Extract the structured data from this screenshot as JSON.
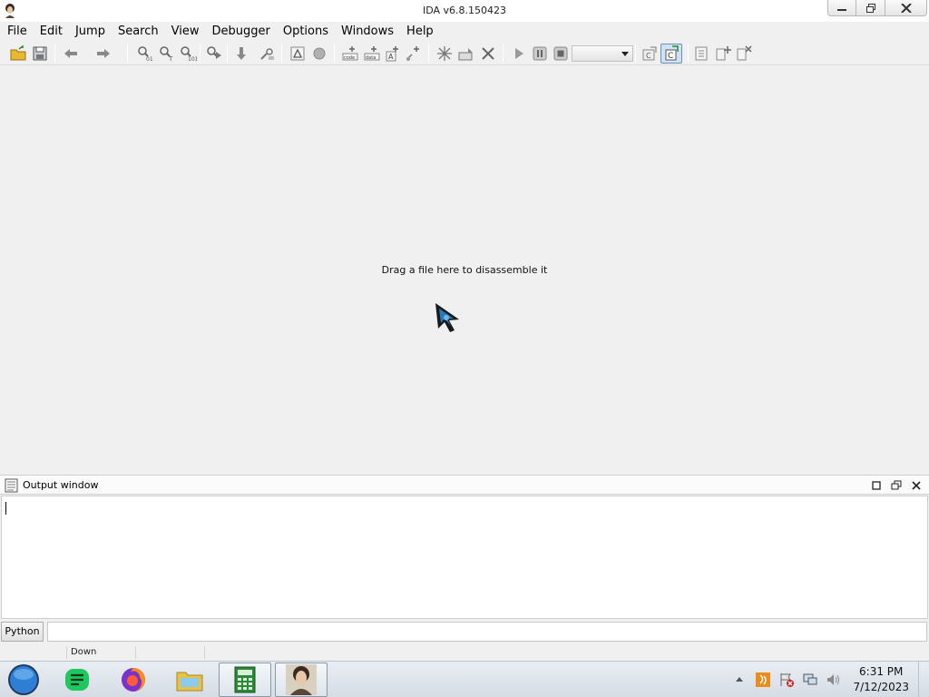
{
  "window": {
    "title": "IDA v6.8.150423"
  },
  "menu": [
    "File",
    "Edit",
    "Jump",
    "Search",
    "View",
    "Debugger",
    "Options",
    "Windows",
    "Help"
  ],
  "toolbar": {
    "icons": [
      "open-icon",
      "save-icon",
      "back-icon",
      "forward-icon",
      "search-binary-icon",
      "search-text-icon",
      "search-immediate-icon",
      "search-next-icon",
      "jump-down-icon",
      "find-icon",
      "graph-icon",
      "circle-icon",
      "make-code-icon",
      "make-data-icon",
      "make-string-icon",
      "make-array-icon",
      "make-function-icon",
      "rename-icon",
      "undefine-icon",
      "start-debugger-icon",
      "pause-icon",
      "stop-icon",
      "debugger-select",
      "switch-debugger-icon",
      "active-debugger-icon",
      "breakpoint-list-icon",
      "add-breakpoint-icon",
      "delete-breakpoint-icon"
    ],
    "debugger_select_value": ""
  },
  "main": {
    "drop_text": "Drag a file here to disassemble it"
  },
  "output": {
    "title": "Output window",
    "content": ""
  },
  "cmdline": {
    "lang_button": "Python",
    "value": ""
  },
  "status": {
    "text": "Down"
  },
  "taskbar": {
    "items": [
      "start-orb",
      "notes-app",
      "firefox",
      "file-explorer",
      "calculator",
      "ida-pro"
    ],
    "clock_time": "6:31 PM",
    "clock_date": "7/12/2023"
  }
}
